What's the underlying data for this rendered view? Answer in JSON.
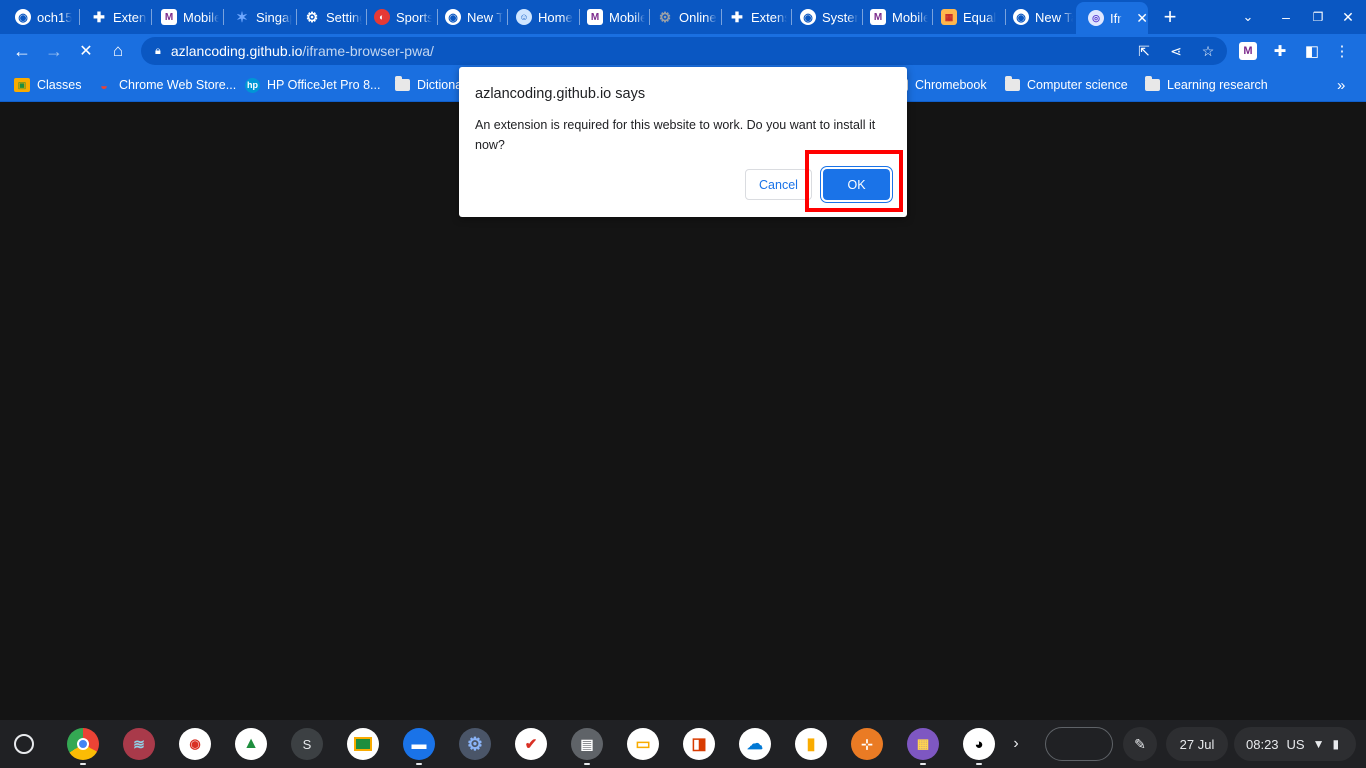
{
  "tabs": [
    {
      "label": "och15",
      "icon": "chrome-icon",
      "active": false
    },
    {
      "label": "Extensions",
      "icon": "puzzle-icon",
      "active": false
    },
    {
      "label": "Mobile",
      "icon": "mobile-icon",
      "active": false
    },
    {
      "label": "Singapore",
      "icon": "globe-icon",
      "active": false
    },
    {
      "label": "Settings",
      "icon": "gear-icon",
      "active": false
    },
    {
      "label": "Sports",
      "icon": "sport-icon",
      "active": false
    },
    {
      "label": "New Tab",
      "icon": "chrome-icon",
      "active": false
    },
    {
      "label": "Home",
      "icon": "globe-icon",
      "active": false
    },
    {
      "label": "Mobile",
      "icon": "mobile-icon",
      "active": false
    },
    {
      "label": "Online",
      "icon": "gear-icon",
      "active": false
    },
    {
      "label": "Extensions",
      "icon": "puzzle-icon",
      "active": false
    },
    {
      "label": "System",
      "icon": "chrome-icon",
      "active": false
    },
    {
      "label": "Mobile",
      "icon": "mobile-icon",
      "active": false
    },
    {
      "label": "Equal",
      "icon": "app-icon",
      "active": false
    },
    {
      "label": "New Tab",
      "icon": "chrome-icon",
      "active": false
    },
    {
      "label": "Ifr",
      "icon": "chrome-icon",
      "active": true
    }
  ],
  "toolbar": {
    "url_host": "azlancoding.github.io",
    "url_path": "/iframe-browser-pwa/"
  },
  "bookmarks": [
    {
      "label": "Classes",
      "icon": "classroom-icon"
    },
    {
      "label": "Chrome Web Store...",
      "icon": "webstore-icon"
    },
    {
      "label": "HP OfficeJet Pro 8...",
      "icon": "hp-icon"
    },
    {
      "label": "Dictiona",
      "icon": "folder-icon"
    },
    {
      "label": "Chromebook",
      "icon": "folder-icon"
    },
    {
      "label": "Computer science",
      "icon": "folder-icon"
    },
    {
      "label": "Learning research",
      "icon": "folder-icon"
    }
  ],
  "dialog": {
    "title": "azlancoding.github.io says",
    "message": "An extension is required for this website to work. Do you want to install it now?",
    "cancel_label": "Cancel",
    "ok_label": "OK"
  },
  "shelf": {
    "apps": [
      {
        "name": "chrome"
      },
      {
        "name": "docker"
      },
      {
        "name": "camera"
      },
      {
        "name": "drive"
      },
      {
        "name": "s-app",
        "letter": "S"
      },
      {
        "name": "classroom"
      },
      {
        "name": "files"
      },
      {
        "name": "settings"
      },
      {
        "name": "mail"
      },
      {
        "name": "docs"
      },
      {
        "name": "slides"
      },
      {
        "name": "office"
      },
      {
        "name": "onedrive"
      },
      {
        "name": "keep"
      },
      {
        "name": "network"
      },
      {
        "name": "canvas"
      },
      {
        "name": "github"
      }
    ],
    "date": "27 Jul",
    "time": "08:23",
    "locale": "US"
  },
  "colors": {
    "frame": "#0a57c2",
    "toolbar": "#1a6fe0",
    "page_bg": "#141414",
    "ok_button": "#1a73e8",
    "highlight": "#ff0000"
  }
}
